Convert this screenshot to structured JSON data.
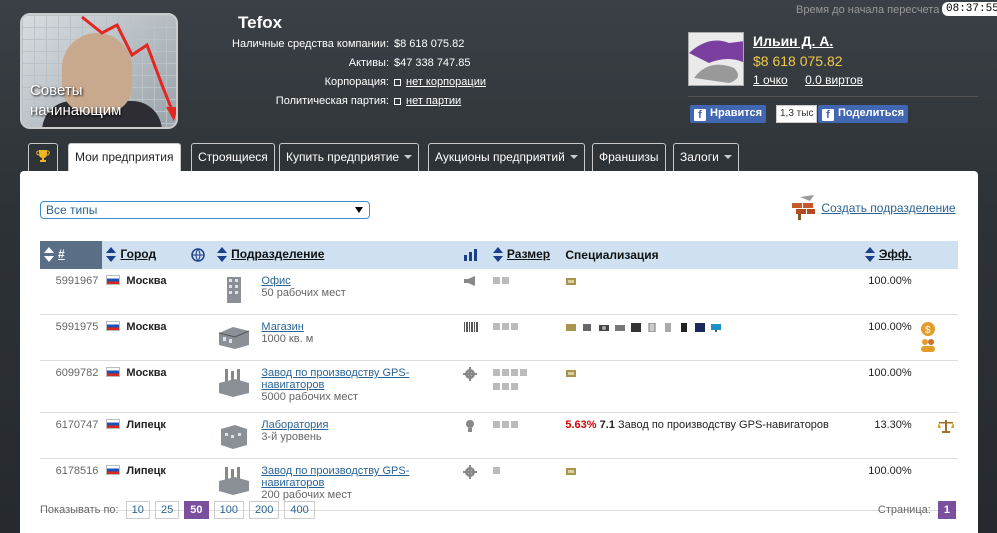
{
  "header": {
    "company_title": "Tefox",
    "logo_text_line1": "Советы",
    "logo_text_line2": "начинающим",
    "stats": [
      {
        "label": "Наличные средства компании:",
        "value": "$8 618 075.82"
      },
      {
        "label": "Активы:",
        "value": "$47 338 747.85"
      },
      {
        "label": "Корпорация:",
        "value": "нет корпорации"
      },
      {
        "label": "Политическая партия:",
        "value": "нет партии"
      }
    ],
    "timer_label": "Время до начала пересчета",
    "timer_value": "08:37:55"
  },
  "user": {
    "name": "Ильин Д. А.",
    "money": "$8 618 075.82",
    "points": "1 очко",
    "virts": "0.0 виртов",
    "fb_like": "Нравится",
    "fb_count": "1,3 тыс",
    "fb_share": "Поделиться"
  },
  "tabs": [
    {
      "label": "",
      "icon": "trophy-icon"
    },
    {
      "label": "Мои предприятия"
    },
    {
      "label": "Строящиеся"
    },
    {
      "label": "Купить предприятие"
    },
    {
      "label": "Аукционы предприятий"
    },
    {
      "label": "Франшизы"
    },
    {
      "label": "Залоги"
    }
  ],
  "filter": {
    "selected": "Все типы",
    "create_label": "Создать подразделение"
  },
  "table": {
    "headers": {
      "id": "#",
      "city": "Город",
      "unit": "Подразделение",
      "size": "Размер",
      "spec": "Специализация",
      "eff": "Эфф."
    },
    "rows": [
      {
        "id": "5991967",
        "city": "Москва",
        "unit": "Офис",
        "sub": "50 рабочих мест",
        "spec": "",
        "eff": "100.00%"
      },
      {
        "id": "5991975",
        "city": "Москва",
        "unit": "Магазин",
        "sub": "1000 кв. м",
        "spec": "",
        "eff": "100.00%"
      },
      {
        "id": "6099782",
        "city": "Москва",
        "unit": "Завод по производству GPS-навигаторов",
        "sub": "5000 рабочих мест",
        "spec": "",
        "eff": "100.00%"
      },
      {
        "id": "6170747",
        "city": "Липецк",
        "unit": "Лаборатория",
        "sub": "3-й уровень",
        "spec_pct": "5.63%",
        "spec_num": "7.1",
        "spec": "Завод по производству GPS-навигаторов",
        "eff": "13.30%"
      },
      {
        "id": "6178516",
        "city": "Липецк",
        "unit": "Завод по производству GPS-навигаторов",
        "sub": "200 рабочих мест",
        "spec": "",
        "eff": "100.00%"
      }
    ]
  },
  "footer": {
    "show_label": "Показывать по:",
    "page_sizes": [
      "10",
      "25",
      "50",
      "100",
      "200",
      "400"
    ],
    "active_size": "50",
    "page_label": "Страница:",
    "page": "1"
  }
}
